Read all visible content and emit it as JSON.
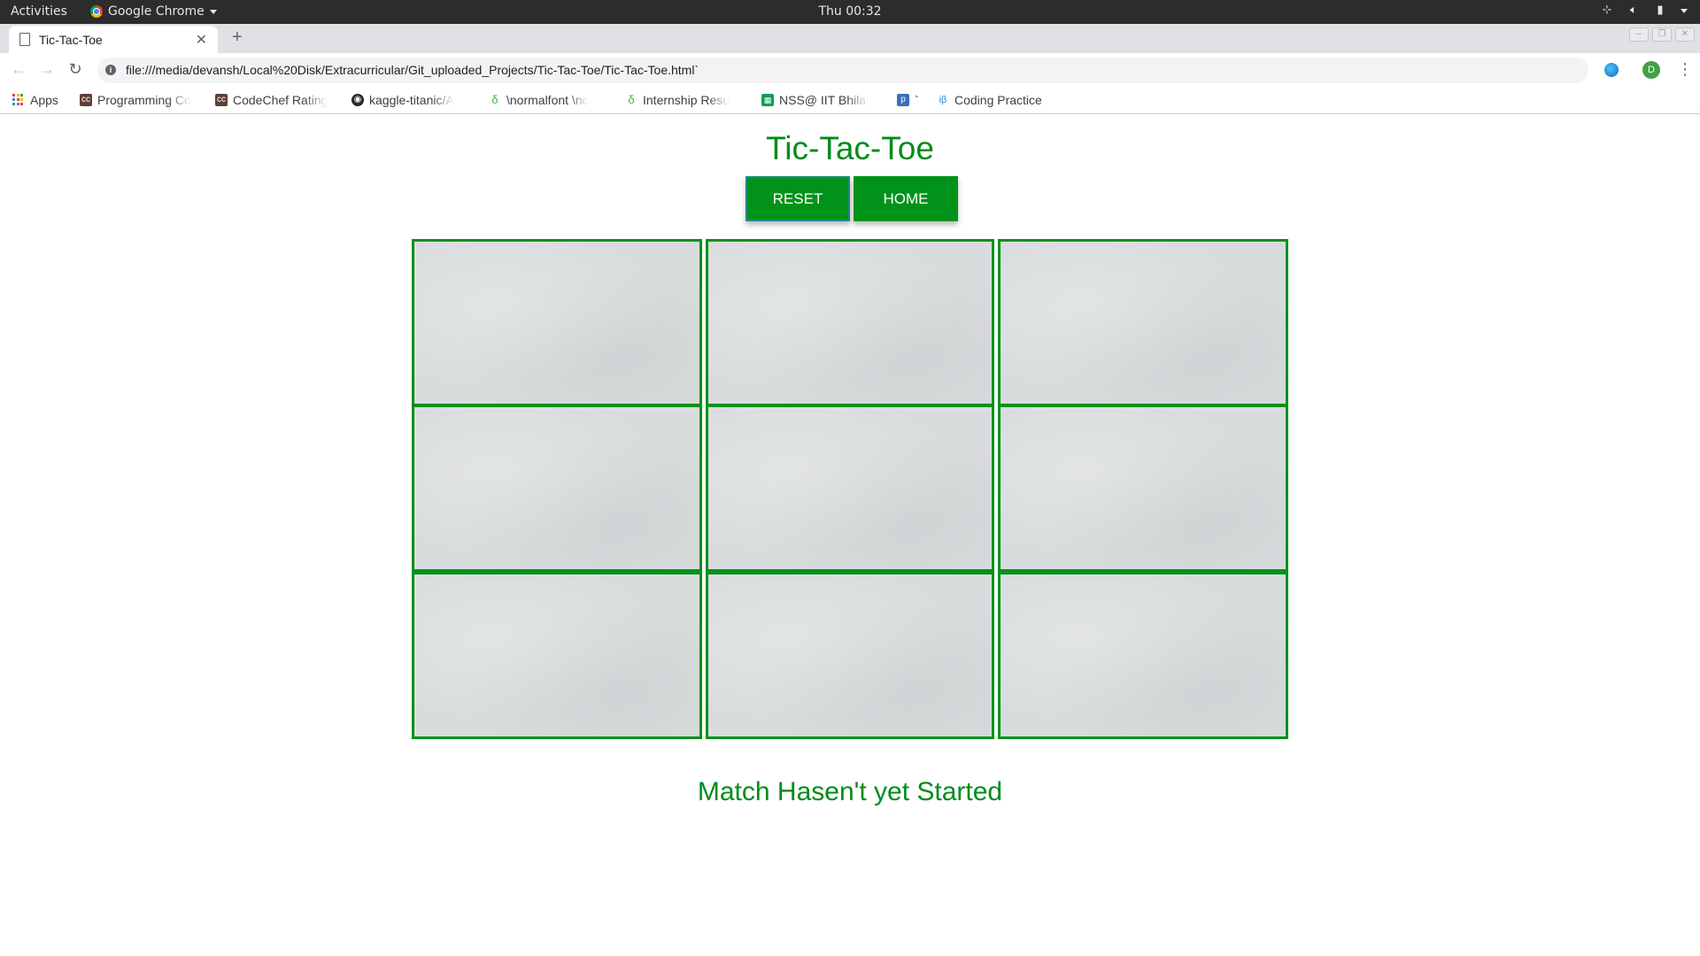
{
  "system_bar": {
    "activities": "Activities",
    "app_name": "Google Chrome",
    "clock": "Thu 00:32"
  },
  "browser": {
    "tab_title": "Tic-Tac-Toe",
    "url": "file:///media/devansh/Local%20Disk/Extracurricular/Git_uploaded_Projects/Tic-Tac-Toe/Tic-Tac-Toe.html`",
    "profile_initial": "D",
    "bookmarks": [
      {
        "label": "Apps",
        "icon": "apps-grid-icon"
      },
      {
        "label": "Programming Co",
        "icon": "codechef-icon"
      },
      {
        "label": "CodeChef Rating",
        "icon": "codechef-icon"
      },
      {
        "label": "kaggle-titanic/A",
        "icon": "github-icon"
      },
      {
        "label": "\\normalfont \\no",
        "icon": "overleaf-icon"
      },
      {
        "label": "Internship Resu",
        "icon": "overleaf-icon"
      },
      {
        "label": "NSS@ IIT Bhilai",
        "icon": "sheets-icon"
      },
      {
        "label": "`",
        "icon": "p-icon"
      },
      {
        "label": "Coding Practice",
        "icon": "interviewbit-icon"
      }
    ]
  },
  "game": {
    "title": "Tic-Tac-Toe",
    "reset_label": "RESET",
    "home_label": "HOME",
    "cells": [
      "",
      "",
      "",
      "",
      "",
      "",
      "",
      "",
      ""
    ],
    "status": "Match Hasen't yet Started"
  },
  "colors": {
    "accent_green": "#01921a",
    "text_green": "#008c1a",
    "cell_background": "#d9dcdd"
  }
}
